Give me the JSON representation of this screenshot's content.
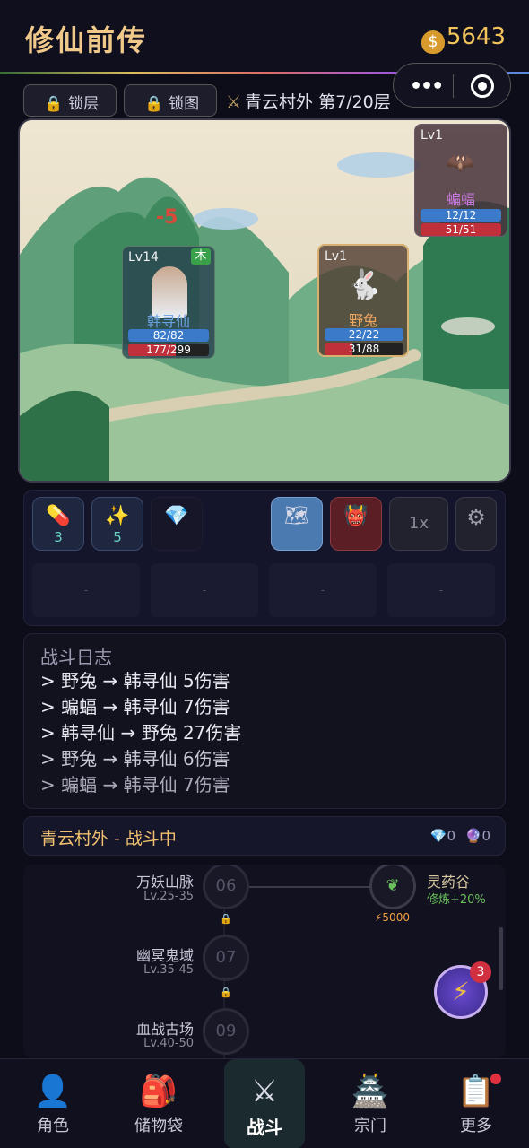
{
  "header": {
    "title": "修仙前传",
    "gold": "5643"
  },
  "toolbar": {
    "lock_floor": "锁层",
    "lock_map": "锁图",
    "location": "青云村外 第7/20层"
  },
  "battle": {
    "damage_popup": "-5",
    "player": {
      "level": "Lv14",
      "element": "木",
      "name": "韩寻仙",
      "mp": "82/82",
      "hp": "177/299",
      "mp_ratio": 1.0,
      "hp_ratio": 0.59
    },
    "enemies": [
      {
        "level": "Lv1",
        "name": "野兔",
        "mp": "22/22",
        "hp": "31/88",
        "mp_ratio": 1.0,
        "hp_ratio": 0.35
      },
      {
        "level": "Lv1",
        "name": "蝙蝠",
        "mp": "12/12",
        "hp": "51/51",
        "mp_ratio": 1.0,
        "hp_ratio": 1.0
      }
    ]
  },
  "items": {
    "pill_count": "3",
    "sparkle_count": "5",
    "speed": "1x",
    "empty_slot": "-"
  },
  "log": {
    "title": "战斗日志",
    "lines": [
      "> 野兔 → 韩寻仙 5伤害",
      "> 蝙蝠 → 韩寻仙 7伤害",
      "> 韩寻仙 → 野兔 27伤害",
      "> 野兔 → 韩寻仙 6伤害",
      "> 蝙蝠 → 韩寻仙 7伤害"
    ]
  },
  "status": {
    "text": "青云村外 - 战斗中",
    "gems": "0",
    "orbs": "0"
  },
  "map": {
    "regions": [
      {
        "name": "万妖山脉",
        "lv": "Lv.25-35",
        "num": "06"
      },
      {
        "name": "幽冥鬼域",
        "lv": "Lv.35-45",
        "num": "07"
      },
      {
        "name": "血战古场",
        "lv": "Lv.40-50",
        "num": "09"
      }
    ],
    "side": {
      "name": "灵药谷",
      "bonus": "修炼+20%",
      "cost": "⚡5000"
    },
    "badge": "3"
  },
  "nav": [
    "角色",
    "储物袋",
    "战斗",
    "宗门",
    "更多"
  ],
  "colors": {
    "accent": "#f0c98a",
    "hp": "#c0303a",
    "mp": "#3a7ac8",
    "gold": "#f2c45a"
  }
}
